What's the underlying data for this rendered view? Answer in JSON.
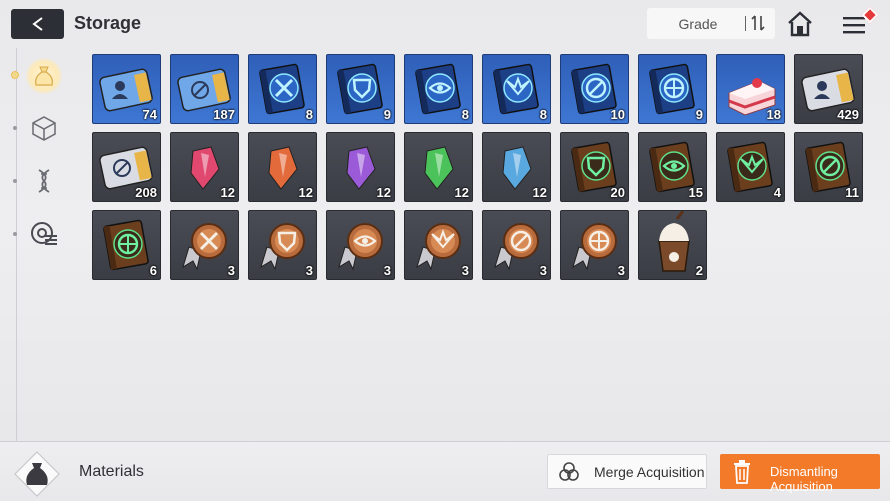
{
  "header": {
    "back_icon": "chevron-left-icon",
    "title": "Storage",
    "sort_label": "Grade",
    "sort_icon": "sort-arrows-icon",
    "home_icon": "home-icon",
    "menu_icon": "hamburger-menu-icon",
    "menu_badge_color": "#e43a3a"
  },
  "sidebar": {
    "items": [
      {
        "icon": "materials-bag-icon",
        "active": true
      },
      {
        "icon": "cube-icon",
        "active": false
      },
      {
        "icon": "dna-helix-icon",
        "active": false
      },
      {
        "icon": "disc-list-icon",
        "active": false
      }
    ]
  },
  "items": [
    {
      "name": "blue-ticket-character",
      "count": "74",
      "bg": "blue"
    },
    {
      "name": "blue-ticket-compass",
      "count": "187",
      "bg": "blue"
    },
    {
      "name": "blue-manual-swords",
      "count": "8",
      "bg": "blue"
    },
    {
      "name": "blue-manual-shield",
      "count": "9",
      "bg": "blue"
    },
    {
      "name": "blue-manual-eye",
      "count": "8",
      "bg": "blue"
    },
    {
      "name": "blue-manual-wings",
      "count": "8",
      "bg": "blue"
    },
    {
      "name": "blue-manual-target",
      "count": "10",
      "bg": "blue"
    },
    {
      "name": "blue-manual-gear",
      "count": "9",
      "bg": "blue"
    },
    {
      "name": "strawberry-cake",
      "count": "18",
      "bg": "blue"
    },
    {
      "name": "gray-ticket-character",
      "count": "429",
      "bg": "gray"
    },
    {
      "name": "gray-ticket-compass",
      "count": "208",
      "bg": "gray"
    },
    {
      "name": "pink-crystal",
      "count": "12",
      "bg": "gray"
    },
    {
      "name": "orange-crystal",
      "count": "12",
      "bg": "gray"
    },
    {
      "name": "purple-crystal",
      "count": "12",
      "bg": "gray"
    },
    {
      "name": "green-crystal",
      "count": "12",
      "bg": "gray"
    },
    {
      "name": "blue-crystal",
      "count": "12",
      "bg": "gray"
    },
    {
      "name": "brown-manual-shield",
      "count": "20",
      "bg": "gray"
    },
    {
      "name": "brown-manual-eye",
      "count": "15",
      "bg": "gray"
    },
    {
      "name": "brown-manual-wings",
      "count": "4",
      "bg": "gray"
    },
    {
      "name": "brown-manual-target",
      "count": "11",
      "bg": "gray"
    },
    {
      "name": "brown-manual-gear",
      "count": "6",
      "bg": "gray"
    },
    {
      "name": "bronze-medal-swords",
      "count": "3",
      "bg": "gray"
    },
    {
      "name": "bronze-medal-shield",
      "count": "3",
      "bg": "gray"
    },
    {
      "name": "bronze-medal-eye",
      "count": "3",
      "bg": "gray"
    },
    {
      "name": "bronze-medal-wings",
      "count": "3",
      "bg": "gray"
    },
    {
      "name": "bronze-medal-target",
      "count": "3",
      "bg": "gray"
    },
    {
      "name": "bronze-medal-gear",
      "count": "3",
      "bg": "gray"
    },
    {
      "name": "chocolate-frappe",
      "count": "2",
      "bg": "gray"
    }
  ],
  "footer": {
    "category_icon": "materials-bag-icon",
    "category_label": "Materials",
    "merge_icon": "merge-circles-icon",
    "merge_label": "Merge Acquisition",
    "dismantle_icon": "trash-icon",
    "dismantle_label": "Dismantling Acquisition",
    "dismantle_color": "#f27a28"
  }
}
